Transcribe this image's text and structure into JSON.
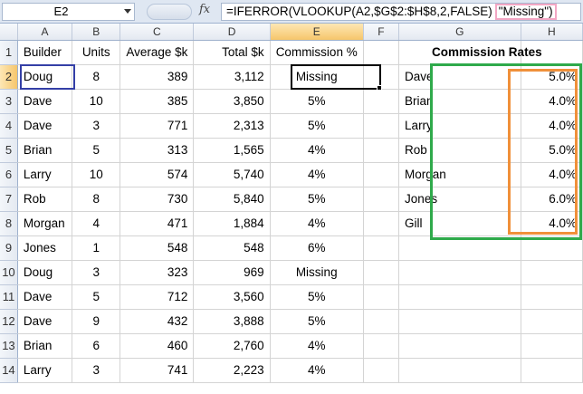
{
  "formula_bar": {
    "name_box": "E2",
    "fx_label": "fx",
    "formula_main": "=IFERROR(VLOOKUP(A2,$G$2:$H$8,2,FALSE)",
    "formula_highlight": "\"Missing\")"
  },
  "columns": [
    "A",
    "B",
    "C",
    "D",
    "E",
    "F",
    "G",
    "H"
  ],
  "rows": [
    [
      "Builder",
      "Units",
      "Average $k",
      "Total $k",
      "Commission %",
      "",
      "Commission Rates",
      ""
    ],
    [
      "Doug",
      "8",
      "389",
      "3,112",
      "Missing",
      "",
      "Dave",
      "5.0%"
    ],
    [
      "Dave",
      "10",
      "385",
      "3,850",
      "5%",
      "",
      "Brian",
      "4.0%"
    ],
    [
      "Dave",
      "3",
      "771",
      "2,313",
      "5%",
      "",
      "Larry",
      "4.0%"
    ],
    [
      "Brian",
      "5",
      "313",
      "1,565",
      "4%",
      "",
      "Rob",
      "5.0%"
    ],
    [
      "Larry",
      "10",
      "574",
      "5,740",
      "4%",
      "",
      "Morgan",
      "4.0%"
    ],
    [
      "Rob",
      "8",
      "730",
      "5,840",
      "5%",
      "",
      "Jones",
      "6.0%"
    ],
    [
      "Morgan",
      "4",
      "471",
      "1,884",
      "4%",
      "",
      "Gill",
      "4.0%"
    ],
    [
      "Jones",
      "1",
      "548",
      "548",
      "6%",
      "",
      "",
      ""
    ],
    [
      "Doug",
      "3",
      "323",
      "969",
      "Missing",
      "",
      "",
      ""
    ],
    [
      "Dave",
      "5",
      "712",
      "3,560",
      "5%",
      "",
      "",
      ""
    ],
    [
      "Dave",
      "9",
      "432",
      "3,888",
      "5%",
      "",
      "",
      ""
    ],
    [
      "Brian",
      "6",
      "460",
      "2,760",
      "4%",
      "",
      "",
      ""
    ],
    [
      "Larry",
      "3",
      "741",
      "2,223",
      "4%",
      "",
      "",
      ""
    ]
  ],
  "active_cell": "E2",
  "colors": {
    "selection_a2": "#343fa6",
    "range_g_h": "#2faa4b",
    "range_h": "#f0903a",
    "formula_highlight": "#f3a7c4"
  }
}
